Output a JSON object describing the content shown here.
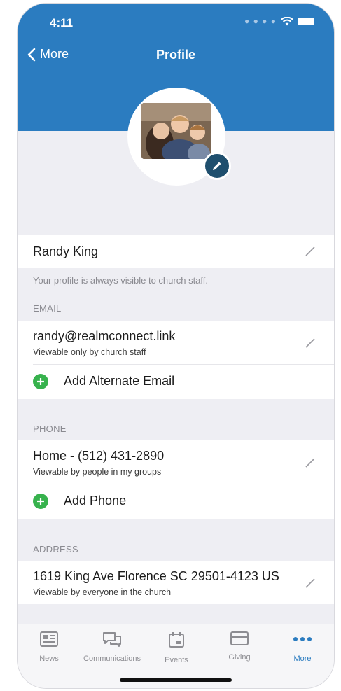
{
  "status": {
    "time": "4:11"
  },
  "nav": {
    "back_label": "More",
    "title": "Profile"
  },
  "profile": {
    "name": "Randy King",
    "visibility_note": "Your profile is always visible to church staff."
  },
  "email": {
    "section_label": "EMAIL",
    "value": "randy@realmconnect.link",
    "visibility": "Viewable only by church staff",
    "add_label": "Add Alternate Email"
  },
  "phone": {
    "section_label": "PHONE",
    "value": "Home - (512) 431-2890",
    "visibility": "Viewable by people in my groups",
    "add_label": "Add Phone"
  },
  "address": {
    "section_label": "ADDRESS",
    "value": "1619 King Ave Florence SC 29501-4123 US",
    "visibility": "Viewable by everyone in the church"
  },
  "tabs": [
    {
      "label": "News",
      "icon": "news-icon",
      "active": false
    },
    {
      "label": "Communications",
      "icon": "communications-icon",
      "active": false
    },
    {
      "label": "Events",
      "icon": "calendar-icon",
      "active": false
    },
    {
      "label": "Giving",
      "icon": "card-icon",
      "active": false
    },
    {
      "label": "More",
      "icon": "more-icon",
      "active": true
    }
  ],
  "colors": {
    "header": "#2b7cc0",
    "accent": "#2b7cc0",
    "add_green": "#37b24d",
    "edit_badge": "#1f4f6e"
  }
}
